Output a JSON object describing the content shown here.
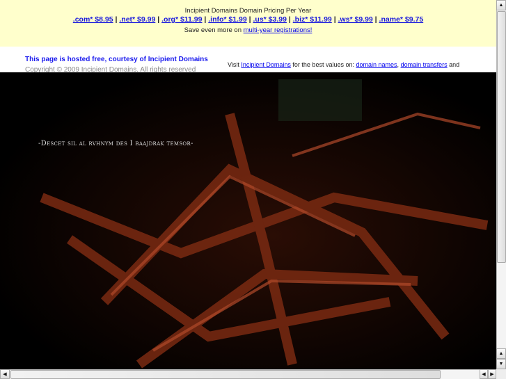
{
  "pricing": {
    "title": "Incipient Domains Domain Pricing Per Year",
    "items": [
      ".com* $8.95",
      ".net* $9.99",
      ".org* $11.99",
      ".info* $1.99",
      ".us* $3.99",
      ".biz* $11.99",
      ".ws* $9.99",
      ".name* $9.75"
    ],
    "save_text": "Save even more on",
    "save_link": "multi-year registrations!"
  },
  "footer": {
    "hosted": "This page is hosted free, courtesy of Incipient Domains",
    "copyright": "Copyright © 2009 Incipient Domains. All rights reserved",
    "visit": "Visit",
    "visit_link": "Incipient Domains",
    "visit_mid": "for the best values on:",
    "link1": "domain names",
    "comma": ",",
    "link2": "domain transfers",
    "and": "and"
  },
  "art": {
    "tagline": "-Descet sil al rvhnym des I baajdrak temsor-"
  },
  "scroll": {
    "vertical_position": 0.0,
    "horizontal_position": 0.0
  }
}
